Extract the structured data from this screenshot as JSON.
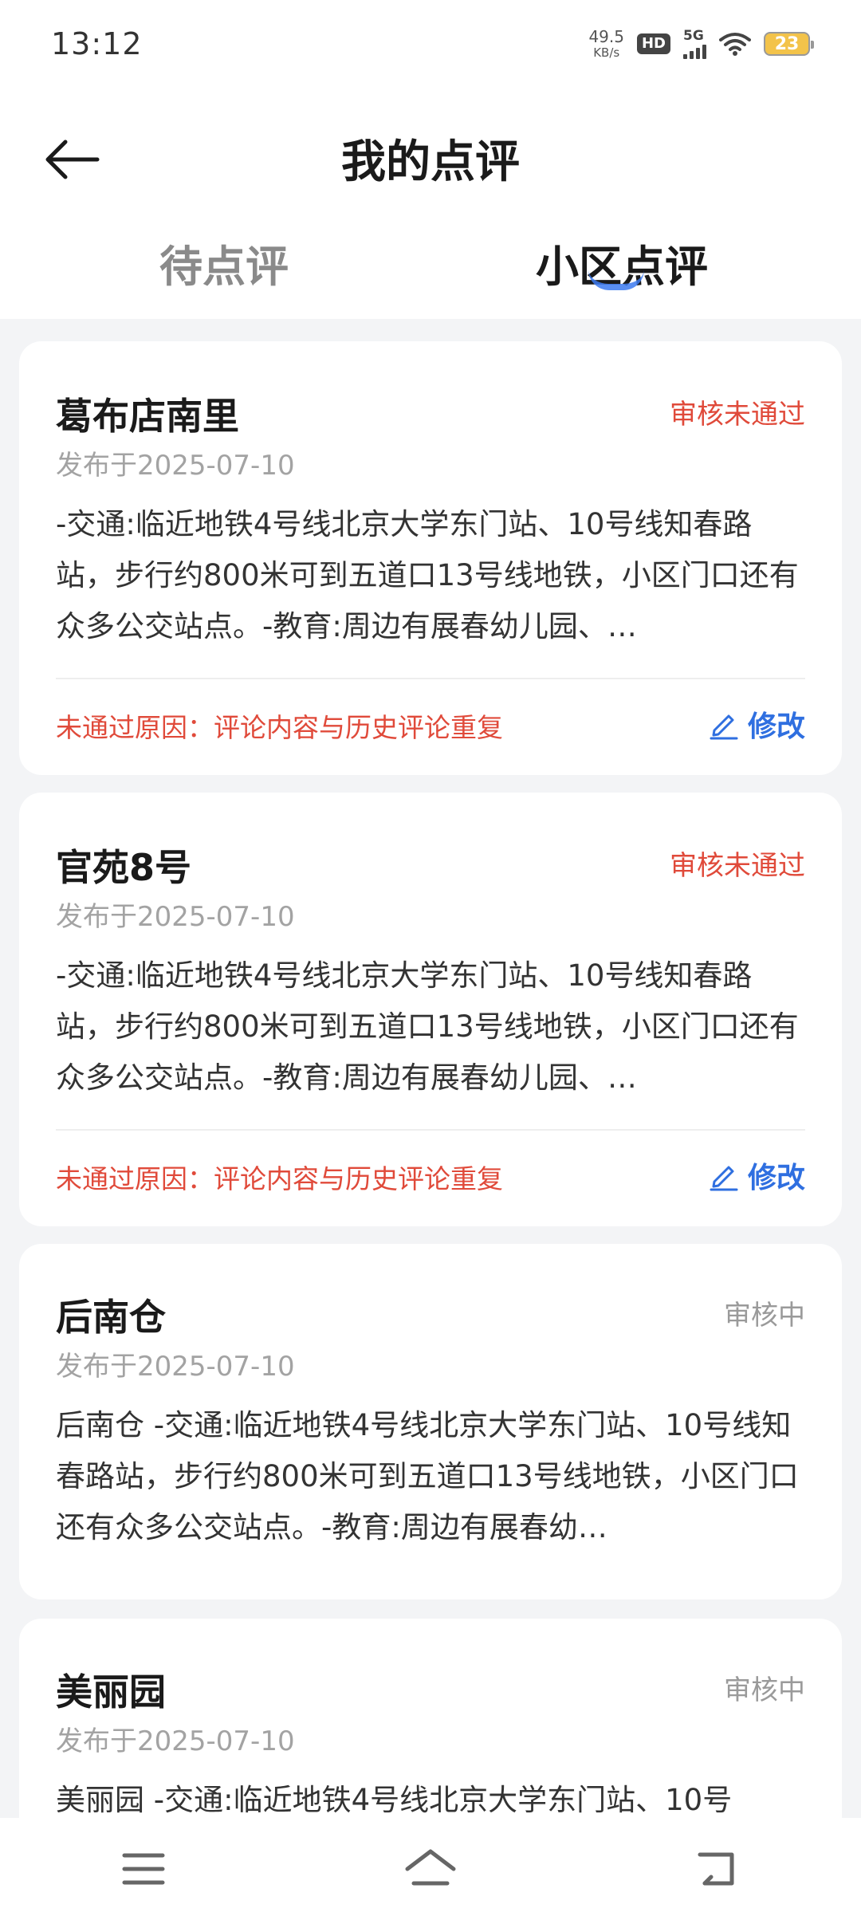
{
  "status_bar": {
    "time": "13:12",
    "speed_value": "49.5",
    "speed_unit": "KB/s",
    "hd_label": "HD",
    "network": "5G",
    "battery": "23"
  },
  "header": {
    "title": "我的点评",
    "tabs": [
      {
        "label": "待点评",
        "active": false
      },
      {
        "label": "小区点评",
        "active": true
      }
    ]
  },
  "reviews": [
    {
      "title": "葛布店南里",
      "status": "审核未通过",
      "date": "发布于2025-07-10",
      "content": "-交通:临近地铁4号线北京大学东门站、10号线知春路站，步行约800米可到五道口13号线地铁，小区门口还有众多公交站点。-教育:周边有展春幼儿园、…",
      "reason": "未通过原因：评论内容与历史评论重复",
      "edit_label": "修改"
    },
    {
      "title": "官苑8号",
      "status": "审核未通过",
      "date": "发布于2025-07-10",
      "content": "-交通:临近地铁4号线北京大学东门站、10号线知春路站，步行约800米可到五道口13号线地铁，小区门口还有众多公交站点。-教育:周边有展春幼儿园、…",
      "reason": "未通过原因：评论内容与历史评论重复",
      "edit_label": "修改"
    },
    {
      "title": "后南仓",
      "status": "审核中",
      "date": "发布于2025-07-10",
      "content": "后南仓 -交通:临近地铁4号线北京大学东门站、10号线知春路站，步行约800米可到五道口13号线地铁，小区门口还有众多公交站点。-教育:周边有展春幼…"
    },
    {
      "title": "美丽园",
      "status": "审核中",
      "date": "发布于2025-07-10",
      "content": "美丽园 -交通:临近地铁4号线北京大学东门站、10号"
    }
  ],
  "colors": {
    "fail": "#e04a3a",
    "review": "#9a9a9a",
    "accent": "#2f6fe0"
  },
  "nav": [
    "menu-icon",
    "home-icon",
    "back-icon"
  ]
}
